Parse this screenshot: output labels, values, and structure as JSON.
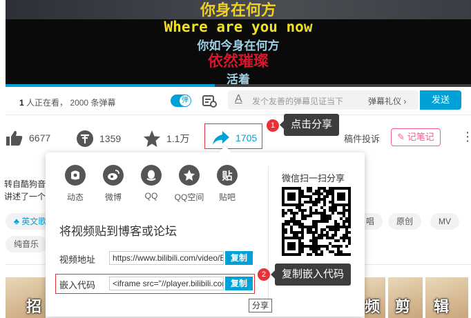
{
  "video": {
    "subtitles": [
      "你身在何方",
      "Where are you now",
      "你如今身在何方",
      "依然璀璨",
      "活着"
    ],
    "progress": 0.45
  },
  "danmaku_bar": {
    "watching_count": "1",
    "watching_text": "人正在看，",
    "danmaku_count": "2000",
    "danmaku_text": "条弹幕",
    "toggle_label": "弹",
    "input_placeholder": "发个友善的弹幕见证当下",
    "etiquette": "弹幕礼仪 ›",
    "send": "发送"
  },
  "actions": {
    "like": "6677",
    "coin": "1359",
    "favorite": "1.1万",
    "share": "1705",
    "appeal": "稿件投诉",
    "notes": "记笔记",
    "more": "⋮"
  },
  "annotations": {
    "step1_number": "1",
    "step1_text": "点击分享",
    "step2_number": "2",
    "step2_text": "复制嵌入代码"
  },
  "description": {
    "line1": "转自酷狗音",
    "line2": "讲述了一个"
  },
  "tags": [
    "英文歌",
    "唱",
    "原创",
    "MV",
    "纯音乐"
  ],
  "thumbnails": [
    "招",
    "频",
    "剪",
    "辑"
  ],
  "share_popup": {
    "items": [
      {
        "icon": "dynamic-icon",
        "label": "动态"
      },
      {
        "icon": "weibo-icon",
        "label": "微博"
      },
      {
        "icon": "qq-icon",
        "label": "QQ"
      },
      {
        "icon": "qzone-icon",
        "label": "QQ空间"
      },
      {
        "icon": "tieba-icon",
        "label": "贴吧"
      }
    ],
    "embed_title": "将视频贴到博客或论坛",
    "video_url_label": "视频地址",
    "video_url_value": "https://www.bilibili.com/video/BV",
    "embed_label": "嵌入代码",
    "embed_value": "<iframe src=\"//player.bilibili.com/player.html",
    "copy_label": "复制",
    "wechat_text": "微信扫一扫分享"
  },
  "tooltip": "分享",
  "colors": {
    "accent": "#00a1d6",
    "annotation_red": "#e8323a",
    "notes_pink": "#f25d8e"
  }
}
